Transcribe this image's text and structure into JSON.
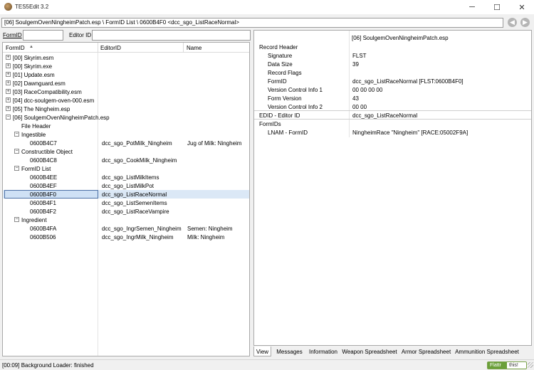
{
  "window": {
    "title": "TES5Edit 3.2",
    "min_glyph": "─",
    "max_glyph": "☐",
    "close_glyph": "✕"
  },
  "path_bar": {
    "text": "[06] SoulgemOvenNingheimPatch.esp \\ FormID List \\ 0600B4F0 <dcc_sgo_ListRaceNormal>",
    "back_glyph": "◀",
    "forward_glyph": "▶"
  },
  "filter": {
    "formid_label": "FormID",
    "formid_value": "",
    "editorid_label": "Editor ID",
    "editorid_value": ""
  },
  "tree": {
    "headers": [
      "FormID",
      "EditorID",
      "Name"
    ],
    "sort_glyph": "▲",
    "rows": [
      {
        "level": 0,
        "expander": "+",
        "col1": "[00] Skyrim.esm",
        "col2": "",
        "col3": "",
        "selected": false
      },
      {
        "level": 0,
        "expander": "+",
        "col1": "[00] Skyrim.exe",
        "col2": "",
        "col3": "",
        "selected": false
      },
      {
        "level": 0,
        "expander": "+",
        "col1": "[01] Update.esm",
        "col2": "",
        "col3": "",
        "selected": false
      },
      {
        "level": 0,
        "expander": "+",
        "col1": "[02] Dawnguard.esm",
        "col2": "",
        "col3": "",
        "selected": false
      },
      {
        "level": 0,
        "expander": "+",
        "col1": "[03] RaceCompatibility.esm",
        "col2": "",
        "col3": "",
        "selected": false
      },
      {
        "level": 0,
        "expander": "+",
        "col1": "[04] dcc-soulgem-oven-000.esm",
        "col2": "",
        "col3": "",
        "selected": false
      },
      {
        "level": 0,
        "expander": "+",
        "col1": "[05] The Ningheim.esp",
        "col2": "",
        "col3": "",
        "selected": false
      },
      {
        "level": 0,
        "expander": "−",
        "col1": "[06] SoulgemOvenNingheimPatch.esp",
        "col2": "",
        "col3": "",
        "selected": false
      },
      {
        "level": 1,
        "expander": "",
        "col1": "File Header",
        "col2": "",
        "col3": "",
        "selected": false
      },
      {
        "level": 1,
        "expander": "−",
        "col1": "Ingestible",
        "col2": "",
        "col3": "",
        "selected": false
      },
      {
        "level": 2,
        "expander": "",
        "col1": "0600B4C7",
        "col2": "dcc_sgo_PotMilk_Ningheim",
        "col3": "Jug of Milk: Ningheim",
        "selected": false
      },
      {
        "level": 1,
        "expander": "−",
        "col1": "Constructible Object",
        "col2": "",
        "col3": "",
        "selected": false
      },
      {
        "level": 2,
        "expander": "",
        "col1": "0600B4C8",
        "col2": "dcc_sgo_CookMilk_Ningheim",
        "col3": "",
        "selected": false
      },
      {
        "level": 1,
        "expander": "−",
        "col1": "FormID List",
        "col2": "",
        "col3": "",
        "selected": false
      },
      {
        "level": 2,
        "expander": "",
        "col1": "0600B4EE",
        "col2": "dcc_sgo_ListMilkItems",
        "col3": "",
        "selected": false
      },
      {
        "level": 2,
        "expander": "",
        "col1": "0600B4EF",
        "col2": "dcc_sgo_ListMilkPot",
        "col3": "",
        "selected": false
      },
      {
        "level": 2,
        "expander": "",
        "col1": "0600B4F0",
        "col2": "dcc_sgo_ListRaceNormal",
        "col3": "",
        "selected": true
      },
      {
        "level": 2,
        "expander": "",
        "col1": "0600B4F1",
        "col2": "dcc_sgo_ListSemenItems",
        "col3": "",
        "selected": false
      },
      {
        "level": 2,
        "expander": "",
        "col1": "0600B4F2",
        "col2": "dcc_sgo_ListRaceVampire",
        "col3": "",
        "selected": false
      },
      {
        "level": 1,
        "expander": "−",
        "col1": "Ingredient",
        "col2": "",
        "col3": "",
        "selected": false
      },
      {
        "level": 2,
        "expander": "",
        "col1": "0600B4FA",
        "col2": "dcc_sgo_IngrSemen_Ningheim",
        "col3": "Semen: Ningheim",
        "selected": false
      },
      {
        "level": 2,
        "expander": "",
        "col1": "0600B506",
        "col2": "dcc_sgo_IngrMilk_Ningheim",
        "col3": "Milk: Ningheim",
        "selected": false
      }
    ]
  },
  "record": {
    "file_header": "[06] SoulgemOvenNingheimPatch.esp",
    "rows": [
      {
        "label": "Record Header",
        "value": "",
        "indent": 0,
        "line_before": false
      },
      {
        "label": "Signature",
        "value": "FLST",
        "indent": 1,
        "line_before": false
      },
      {
        "label": "Data Size",
        "value": "39",
        "indent": 1,
        "line_before": false
      },
      {
        "label": "Record Flags",
        "value": "",
        "indent": 1,
        "line_before": false
      },
      {
        "label": "FormID",
        "value": "dcc_sgo_ListRaceNormal [FLST:0600B4F0]",
        "indent": 1,
        "line_before": false
      },
      {
        "label": "Version Control Info 1",
        "value": "00 00 00 00",
        "indent": 1,
        "line_before": false
      },
      {
        "label": "Form Version",
        "value": "43",
        "indent": 1,
        "line_before": false
      },
      {
        "label": "Version Control Info 2",
        "value": "00 00",
        "indent": 1,
        "line_before": false
      },
      {
        "label": "EDID - Editor ID",
        "value": "dcc_sgo_ListRaceNormal",
        "indent": 0,
        "line_before": true
      },
      {
        "label": "FormIDs",
        "value": "",
        "indent": 0,
        "line_before": true
      },
      {
        "label": "LNAM - FormID",
        "value": "NingheimRace \"Ningheim\" [RACE:05002F9A]",
        "indent": 1,
        "line_before": false
      }
    ]
  },
  "tabs": [
    "View",
    "Messages",
    "Information",
    "Weapon Spreadsheet",
    "Armor Spreadsheet",
    "Ammunition Spreadsheet"
  ],
  "status": {
    "text": "[00:09] Background Loader: finished",
    "flattr_left": "Flattr",
    "flattr_right": "this!"
  },
  "colors": {
    "selection": "#dbe8f6",
    "selection_border": "#4a6fa5",
    "flattr_green": "#6ba03a"
  }
}
